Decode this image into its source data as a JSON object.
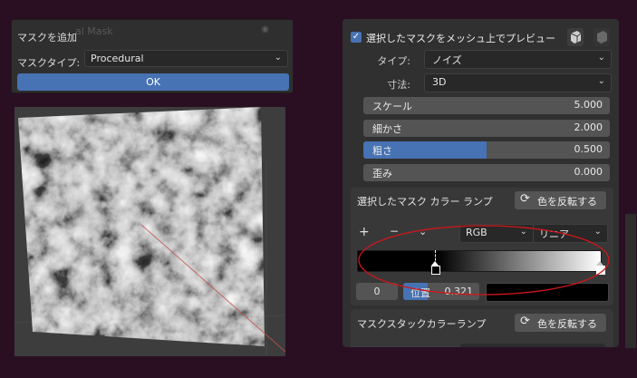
{
  "dialog": {
    "title": "マスクを追加",
    "ghost_text": "al Mask",
    "mask_type_label": "マスクタイプ:",
    "mask_type_value": "Procedural",
    "ok_label": "OK"
  },
  "panel": {
    "preview_label": "選択したマスクをメッシュ上でプレビュー",
    "preview_checked": true,
    "type_label": "タイプ:",
    "type_value": "ノイズ",
    "dimension_label": "寸法:",
    "dimension_value": "3D",
    "sliders": [
      {
        "label": "スケール",
        "value": "5.000",
        "fraction": 0
      },
      {
        "label": "細かさ",
        "value": "2.000",
        "fraction": 0
      },
      {
        "label": "粗さ",
        "value": "0.500",
        "fraction": 0.5
      },
      {
        "label": "歪み",
        "value": "0.000",
        "fraction": 0
      }
    ],
    "ramp1": {
      "title": "選択したマスク カラー ランプ",
      "invert_label": "色を反転する",
      "add_symbol": "+",
      "remove_symbol": "−",
      "menu_symbol": "⌄",
      "color_mode": "RGB",
      "interpolation": "リニア",
      "stops": [
        0.321,
        1.0
      ],
      "index": "0",
      "pos_label": "位置",
      "pos_value": "0.321",
      "stop_color": "#000000"
    },
    "ramp2": {
      "title": "マスクスタックカラーランプ",
      "invert_label": "色を反転する"
    }
  },
  "colors": {
    "accent": "#4772b3",
    "annotation": "#d0161c"
  }
}
